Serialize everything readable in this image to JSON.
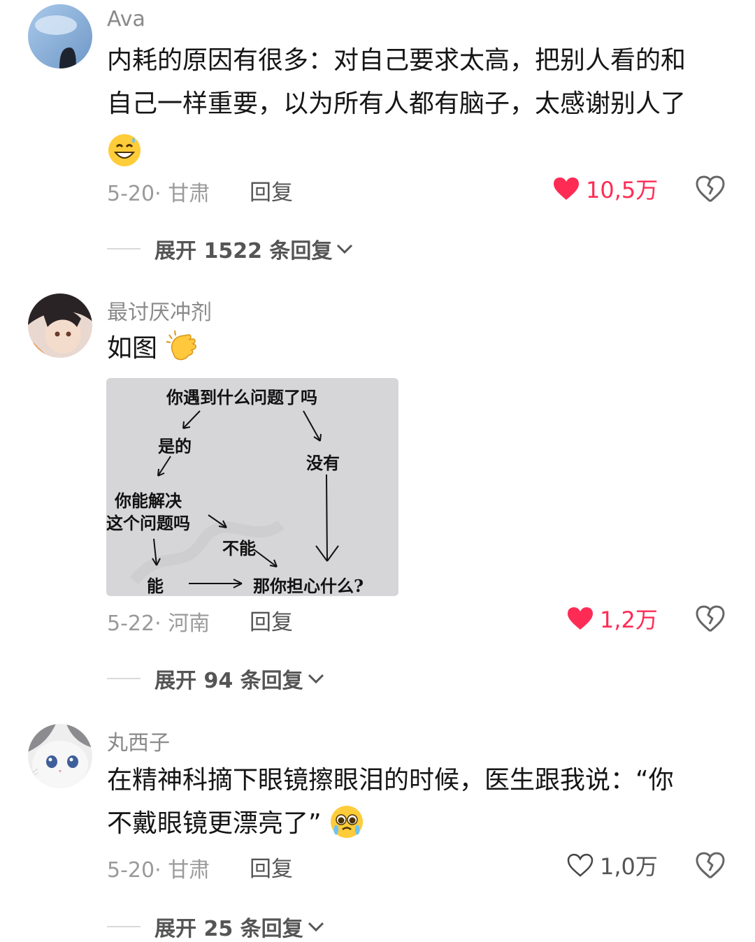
{
  "comments": [
    {
      "username": "Ava",
      "text_line1": "内耗的原因有很多：对自己要求太高，把别人看的和",
      "text_line2": "自己一样重要，以为所有人都有脑子，太感谢别人了",
      "date": "5-20",
      "separator": "·",
      "location": "甘肃",
      "reply_label": "回复",
      "likes": "10,5万",
      "liked": true,
      "expand_label": "展开 1522 条回复",
      "emoji": "grinning-sweat-emoji"
    },
    {
      "username": "最讨厌冲剂",
      "text": "如图",
      "emoji": "clapping-hands-emoji",
      "date": "5-22",
      "separator": "·",
      "location": "河南",
      "reply_label": "回复",
      "likes": "1,2万",
      "liked": true,
      "expand_label": "展开 94 条回复",
      "image": {
        "question": "你遇到什么问题了吗",
        "yes": "是的",
        "no": "没有",
        "can_solve_line1": "你能解决",
        "can_solve_line2": "这个问题吗",
        "cannot": "不能",
        "can": "能",
        "why_worry": "那你担心什么?"
      }
    },
    {
      "username": "丸西子",
      "text_line1": "在精神科摘下眼镜擦眼泪的时候，医生跟我说：“你",
      "text_line2": "不戴眼镜更漂亮了”",
      "emoji": "pleading-crying-emoji",
      "date": "5-20",
      "separator": "·",
      "location": "甘肃",
      "reply_label": "回复",
      "likes": "1,0万",
      "liked": false,
      "expand_label": "展开 25 条回复"
    }
  ],
  "colors": {
    "like_red": "#fe2c55",
    "meta_gray": "#9a9a9a",
    "text_dark": "#151515"
  }
}
